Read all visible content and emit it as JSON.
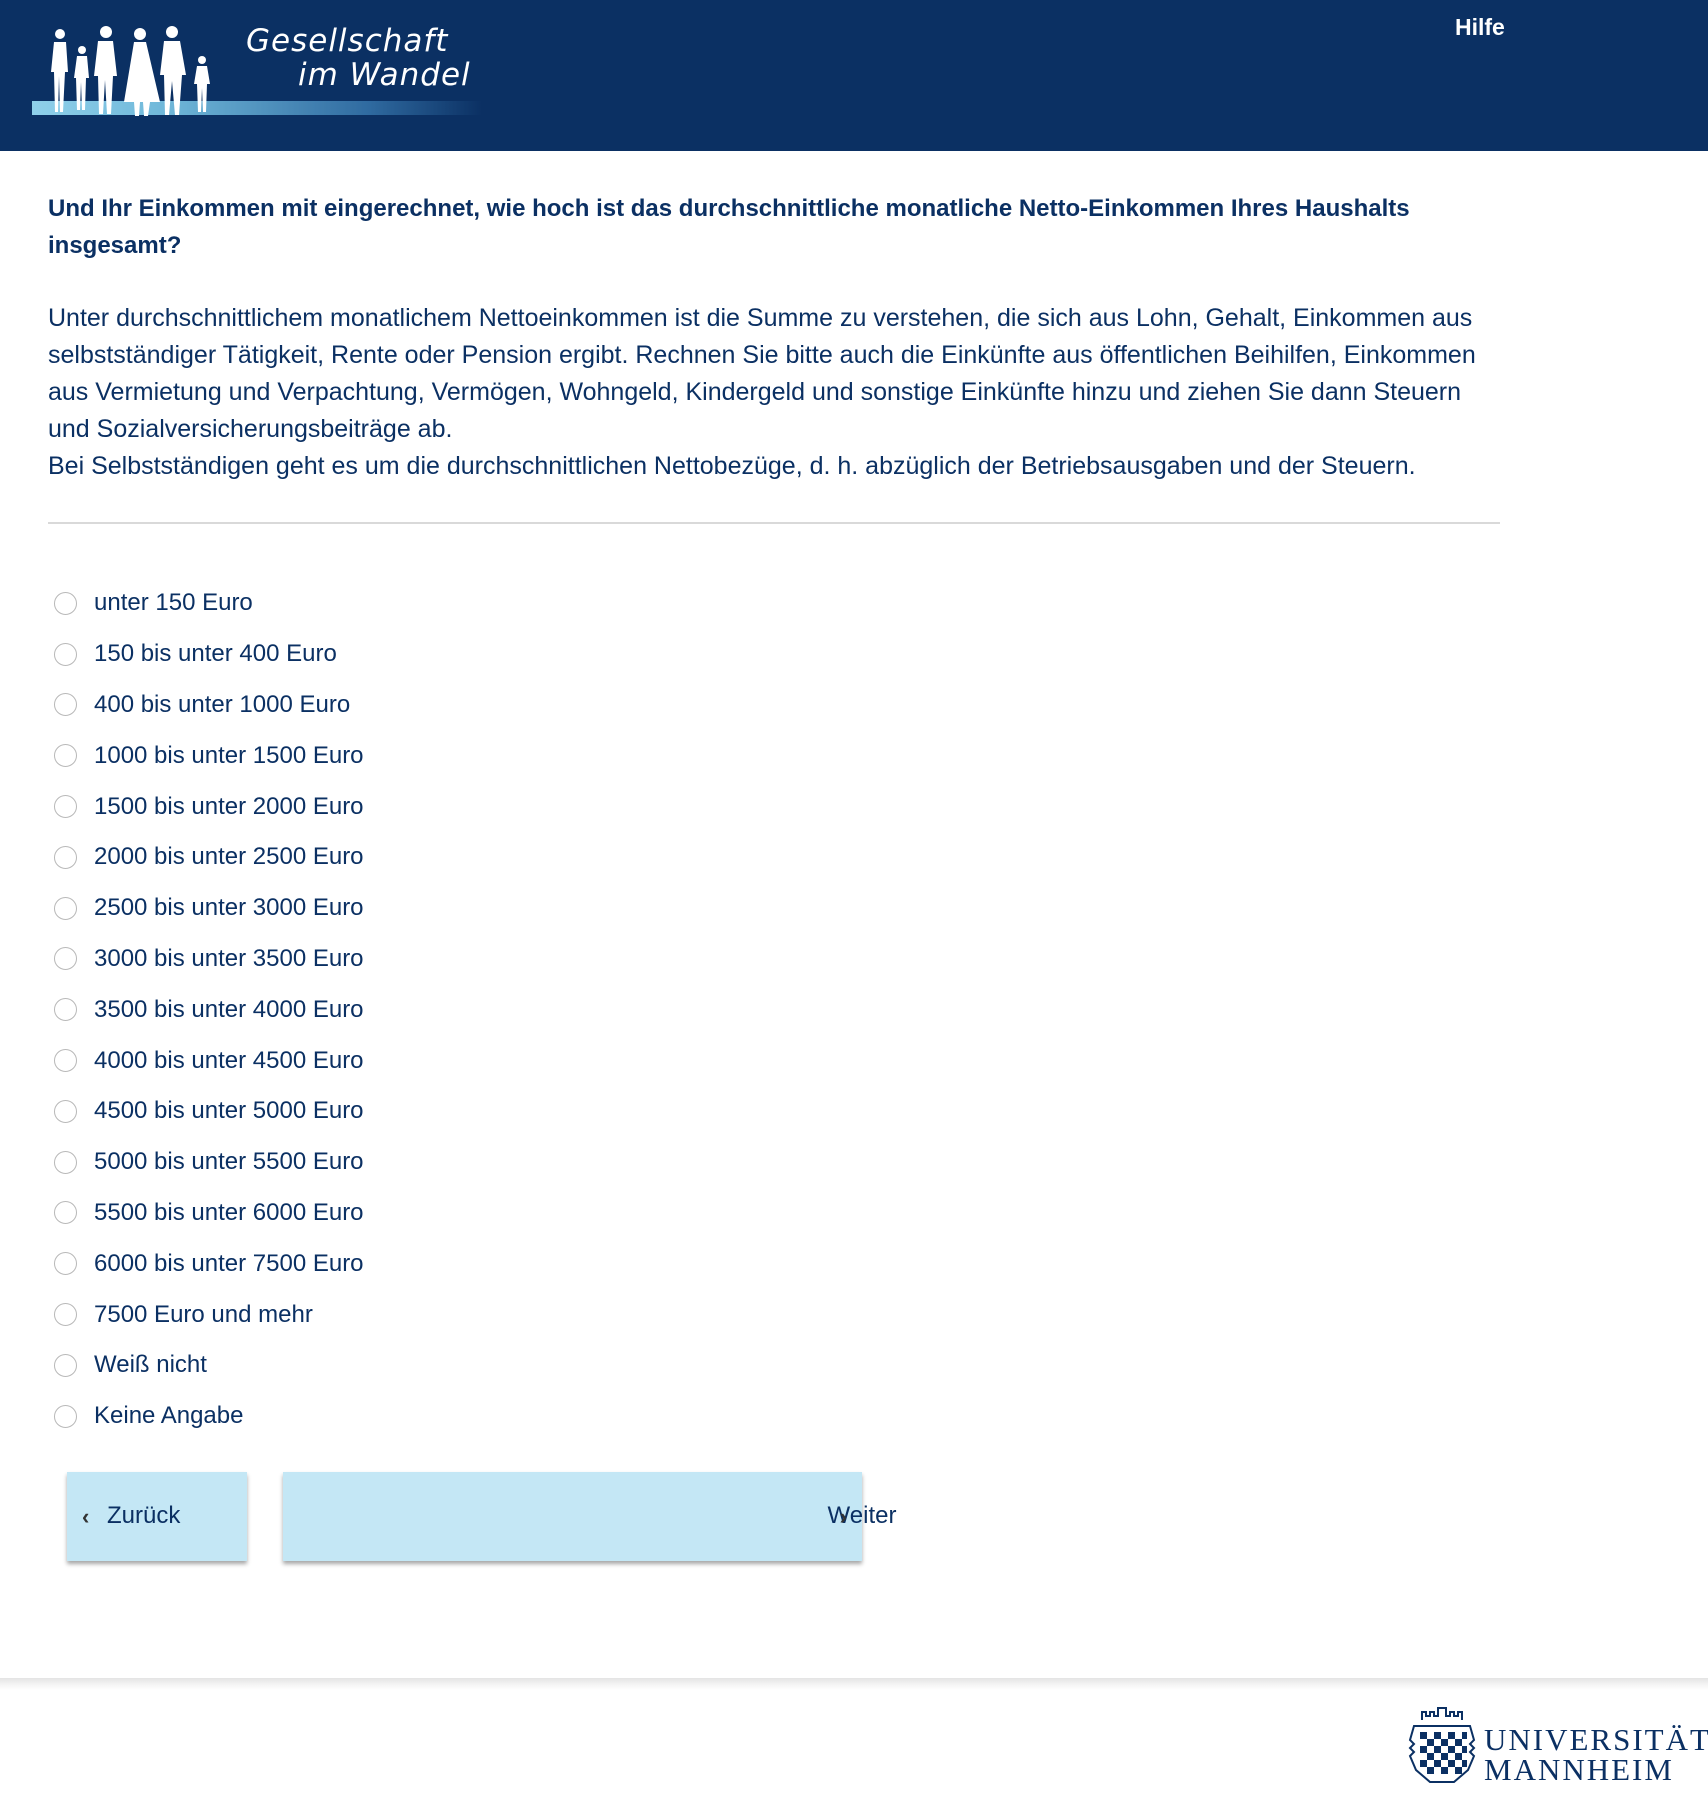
{
  "header": {
    "logo_line1": "Gesellschaft",
    "logo_line2": "im Wandel",
    "help_label": "Hilfe",
    "background_color": "#0b3063"
  },
  "question": {
    "title": "Und Ihr Einkommen mit eingerechnet, wie hoch ist das durchschnittliche monatliche Netto-Einkommen Ihres Haushalts insgesamt?",
    "explanation_line1": "Unter durchschnittlichem monatlichem Nettoeinkommen ist die Summe zu verstehen, die sich aus Lohn, Gehalt, Einkommen aus selbstständiger Tätigkeit, Rente oder Pension ergibt. Rechnen Sie bitte auch die Einkünfte aus öffentlichen Beihilfen, Einkommen aus Vermietung und Verpachtung, Vermögen, Wohngeld, Kindergeld und sonstige Einkünfte hinzu und ziehen Sie dann Steuern und Sozialversicherungsbeiträge ab.",
    "explanation_line2": "Bei Selbstständigen geht es um die durchschnittlichen Nettobezüge, d. h. abzüglich der Betriebsausgaben und der Steuern."
  },
  "options": [
    "unter 150 Euro",
    "150 bis unter 400 Euro",
    "400 bis unter 1000 Euro",
    "1000 bis unter 1500 Euro",
    "1500 bis unter 2000 Euro",
    "2000 bis unter 2500 Euro",
    "2500 bis unter 3000 Euro",
    "3000 bis unter 3500 Euro",
    "3500 bis unter 4000 Euro",
    "4000 bis unter 4500 Euro",
    "4500 bis unter 5000 Euro",
    "5000 bis unter 5500 Euro",
    "5500 bis unter 6000 Euro",
    "6000 bis unter 7500 Euro",
    "7500 Euro und mehr",
    "Weiß nicht",
    "Keine Angabe"
  ],
  "navigation": {
    "back_label": "Zurück",
    "next_label": "Weiter",
    "back_icon": "chevron-left-icon",
    "next_icon": "chevron-right-icon",
    "button_color": "#c4e7f5"
  },
  "footer": {
    "university_line1": "UNIVERSITÄT",
    "university_line2": "MANNHEIM"
  }
}
